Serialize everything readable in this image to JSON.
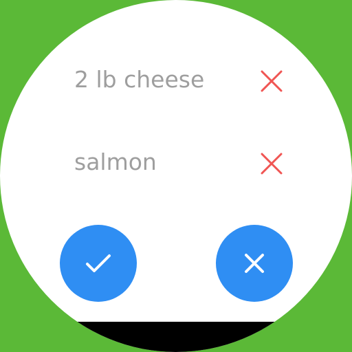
{
  "colors": {
    "background": "#5bb937",
    "face": "#ffffff",
    "item_text": "#9e9e9e",
    "remove_icon": "#f05553",
    "fab": "#2f8ef3",
    "fab_icon": "#ffffff",
    "bottom_bar": "#000000"
  },
  "items": [
    {
      "label": "2 lb cheese",
      "icon": "close-icon"
    },
    {
      "label": "salmon",
      "icon": "close-icon"
    }
  ],
  "actions": {
    "confirm_icon": "check-icon",
    "cancel_icon": "close-icon"
  }
}
